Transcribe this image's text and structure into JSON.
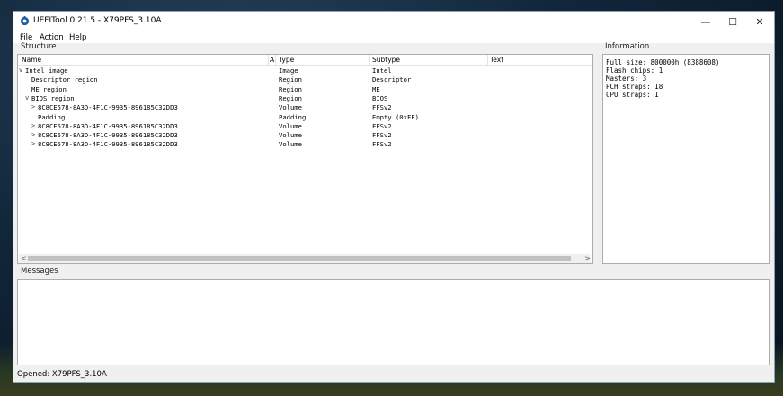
{
  "window": {
    "title": "UEFITool 0.21.5 - X79PFS_3.10A"
  },
  "titlebar_controls": {
    "minimize": "—",
    "maximize": "☐",
    "close": "✕"
  },
  "menu": [
    "File",
    "Action",
    "Help"
  ],
  "structure": {
    "label": "Structure",
    "columns": [
      "Name",
      "A",
      "Type",
      "Subtype",
      "Text"
    ],
    "rows": [
      {
        "expander": "v",
        "name": "Intel image",
        "type": "Image",
        "subtype": "Intel",
        "text": ""
      },
      {
        "expander": "",
        "name": "Descriptor region",
        "type": "Region",
        "subtype": "Descriptor",
        "text": ""
      },
      {
        "expander": "",
        "name": "ME region",
        "type": "Region",
        "subtype": "ME",
        "text": ""
      },
      {
        "expander": "v",
        "name": "BIOS region",
        "type": "Region",
        "subtype": "BIOS",
        "text": ""
      },
      {
        "expander": ">",
        "name": "8C8CE578-8A3D-4F1C-9935-896185C32DD3",
        "type": "Volume",
        "subtype": "FFSv2",
        "text": ""
      },
      {
        "expander": "",
        "name": "Padding",
        "type": "Padding",
        "subtype": "Empty (0xFF)",
        "text": ""
      },
      {
        "expander": ">",
        "name": "8C8CE578-8A3D-4F1C-9935-896185C32DD3",
        "type": "Volume",
        "subtype": "FFSv2",
        "text": ""
      },
      {
        "expander": ">",
        "name": "8C8CE578-8A3D-4F1C-9935-896185C32DD3",
        "type": "Volume",
        "subtype": "FFSv2",
        "text": ""
      },
      {
        "expander": ">",
        "name": "8C8CE578-8A3D-4F1C-9935-896185C32DD3",
        "type": "Volume",
        "subtype": "FFSv2",
        "text": ""
      }
    ],
    "scroll_left": "<",
    "scroll_right": ">"
  },
  "information": {
    "label": "Information",
    "lines": [
      "Full size: 800000h (8388608)",
      "Flash chips: 1",
      "Masters: 3",
      "PCH straps: 18",
      "CPU straps: 1"
    ]
  },
  "messages": {
    "label": "Messages"
  },
  "status": {
    "text": "Opened: X79PFS_3.10A"
  },
  "colors": {
    "icon_blue": "#1e5fa8",
    "border": "#adadad",
    "window_bg": "#f0f0f0"
  }
}
